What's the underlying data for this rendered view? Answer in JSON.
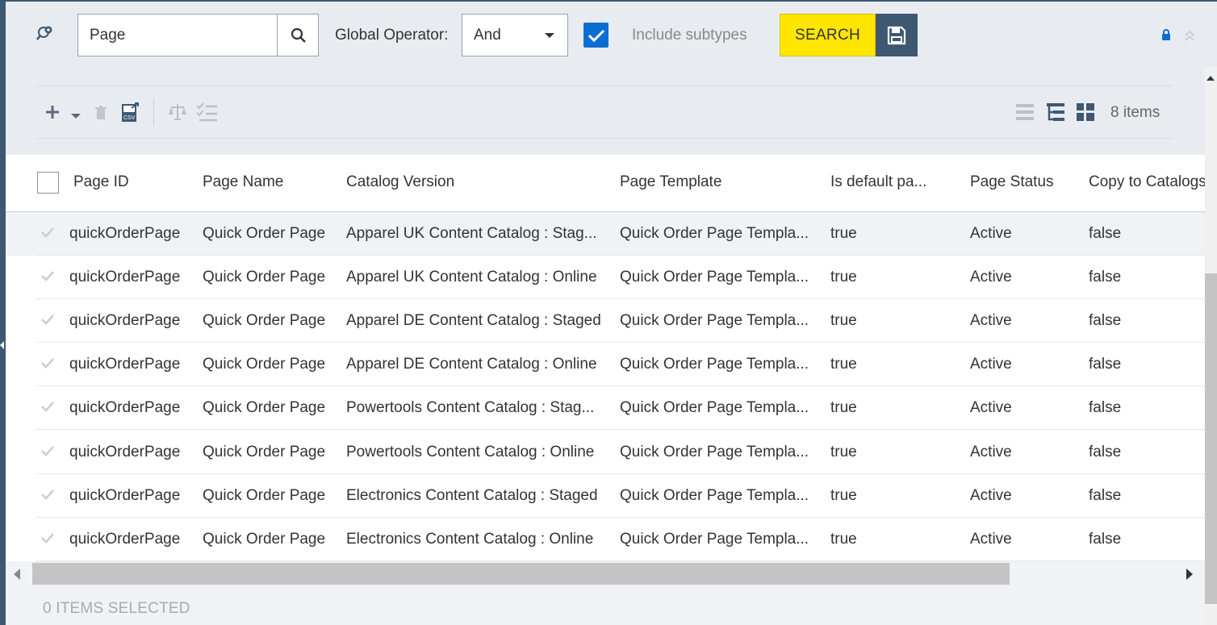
{
  "search": {
    "value": "Page",
    "global_operator_label": "Global Operator:",
    "global_operator_value": "And",
    "include_subtypes_label": "Include subtypes",
    "include_subtypes_checked": true,
    "search_button_label": "SEARCH"
  },
  "toolbar": {
    "items_count": "8 items"
  },
  "table": {
    "columns": [
      "Page ID",
      "Page Name",
      "Catalog Version",
      "Page Template",
      "Is default pa...",
      "Page Status",
      "Copy to Catalogs"
    ],
    "rows": [
      {
        "page_id": "quickOrderPage",
        "page_name": "Quick Order Page",
        "catalog_version": "Apparel UK Content Catalog : Stag...",
        "page_template": "Quick Order Page Templa...",
        "is_default": "true",
        "status": "Active",
        "copy_to_catalogs": "false"
      },
      {
        "page_id": "quickOrderPage",
        "page_name": "Quick Order Page",
        "catalog_version": "Apparel UK Content Catalog : Online",
        "page_template": "Quick Order Page Templa...",
        "is_default": "true",
        "status": "Active",
        "copy_to_catalogs": "false"
      },
      {
        "page_id": "quickOrderPage",
        "page_name": "Quick Order Page",
        "catalog_version": "Apparel DE Content Catalog : Staged",
        "page_template": "Quick Order Page Templa...",
        "is_default": "true",
        "status": "Active",
        "copy_to_catalogs": "false"
      },
      {
        "page_id": "quickOrderPage",
        "page_name": "Quick Order Page",
        "catalog_version": "Apparel DE Content Catalog : Online",
        "page_template": "Quick Order Page Templa...",
        "is_default": "true",
        "status": "Active",
        "copy_to_catalogs": "false"
      },
      {
        "page_id": "quickOrderPage",
        "page_name": "Quick Order Page",
        "catalog_version": "Powertools Content Catalog : Stag...",
        "page_template": "Quick Order Page Templa...",
        "is_default": "true",
        "status": "Active",
        "copy_to_catalogs": "false"
      },
      {
        "page_id": "quickOrderPage",
        "page_name": "Quick Order Page",
        "catalog_version": "Powertools Content Catalog : Online",
        "page_template": "Quick Order Page Templa...",
        "is_default": "true",
        "status": "Active",
        "copy_to_catalogs": "false"
      },
      {
        "page_id": "quickOrderPage",
        "page_name": "Quick Order Page",
        "catalog_version": "Electronics Content Catalog : Staged",
        "page_template": "Quick Order Page Templa...",
        "is_default": "true",
        "status": "Active",
        "copy_to_catalogs": "false"
      },
      {
        "page_id": "quickOrderPage",
        "page_name": "Quick Order Page",
        "catalog_version": "Electronics Content Catalog : Online",
        "page_template": "Quick Order Page Templa...",
        "is_default": "true",
        "status": "Active",
        "copy_to_catalogs": "false"
      }
    ]
  },
  "footer": {
    "selection_status": "0 ITEMS SELECTED"
  },
  "colors": {
    "search_button": "#ffe600",
    "save_button": "#3f5872",
    "checkbox": "#0a6ed1",
    "lock_icon": "#0a6ed1"
  },
  "icons": [
    "advanced-search-icon",
    "search-icon",
    "check-icon",
    "save-icon",
    "lock-icon",
    "collapse-up-icon",
    "add-icon",
    "dropdown-icon",
    "delete-icon",
    "csv-export-icon",
    "compare-icon",
    "bulk-edit-icon",
    "list-view-icon",
    "tree-view-icon",
    "grid-view-icon",
    "row-check-icon"
  ]
}
